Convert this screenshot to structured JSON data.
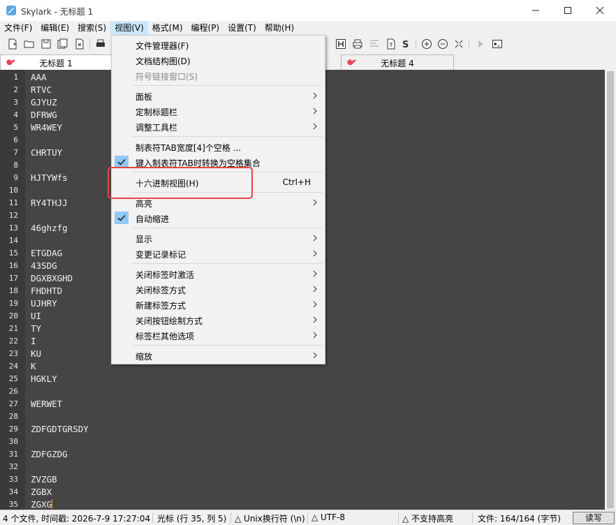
{
  "window": {
    "title": "Skylark - 无标题 1"
  },
  "menubar": [
    {
      "label": "文件(F)"
    },
    {
      "label": "编辑(E)"
    },
    {
      "label": "搜索(S)"
    },
    {
      "label": "视图(V)"
    },
    {
      "label": "格式(M)"
    },
    {
      "label": "编程(P)"
    },
    {
      "label": "设置(T)"
    },
    {
      "label": "帮助(H)"
    }
  ],
  "toolbar": {
    "icons": [
      "new-file-icon",
      "open-folder-icon",
      "save-icon",
      "save-all-icon",
      "close-file-icon",
      "print-icon",
      "hex-view-icon",
      "printer-icon",
      "align-icon",
      "text-file-icon",
      "s-icon",
      "zoom-in-icon",
      "zoom-out-icon",
      "fullscreen-icon",
      "run-icon",
      "terminal-icon"
    ]
  },
  "tabs": [
    {
      "label": "无标题 1",
      "active": true
    },
    {
      "label": "无标题 4",
      "active": false
    }
  ],
  "editor": {
    "lines": [
      "AAA",
      "RTVC",
      "GJYUZ",
      "DFRWG",
      "WR4WEY",
      "",
      "CHRTUY",
      "",
      "HJTYWfs",
      "",
      "RY4THJJ",
      "",
      "46ghzfg",
      "",
      "ETGDAG",
      "43SDG",
      "DGXBXGHD",
      "FHDHTD",
      "UJHRY",
      "UI",
      "TY",
      "I",
      "KU",
      "K",
      "HGKLY",
      "",
      "WERWET",
      "",
      "ZDFGDTGRSDY",
      "",
      "ZDFGZDG",
      "",
      "ZVZGB",
      "ZGBX",
      "ZGXG"
    ]
  },
  "statusbar": {
    "files": "4 个文件, 时间戳: 2026-7-9 17:27:04",
    "cursor": "光标 (行 35, 列 5)",
    "eol": "△ Unix换行符 (\\n)",
    "encoding": "△ UTF-8",
    "highlight": "△ 不支持高亮",
    "size": "文件: 164/164 (字节)",
    "mode": "读写"
  },
  "view_menu": {
    "items": [
      {
        "label": "文件管理器(F)"
      },
      {
        "label": "文档结构图(D)"
      },
      {
        "label": "符号链接窗口(S)",
        "disabled": true
      },
      {
        "label": "面板",
        "submenu": true
      },
      {
        "label": "定制标题栏",
        "submenu": true
      },
      {
        "label": "调整工具栏",
        "submenu": true
      },
      {
        "label": "制表符TAB宽度[4]个空格 ..."
      },
      {
        "label": "键入制表符TAB时转换为空格集合",
        "checked": true
      },
      {
        "label": "十六进制视图(H)",
        "shortcut": "Ctrl+H"
      },
      {
        "label": "高亮",
        "submenu": true
      },
      {
        "label": "自动缩进",
        "checked": true
      },
      {
        "label": "显示",
        "submenu": true
      },
      {
        "label": "变更记录标记",
        "submenu": true
      },
      {
        "label": "关闭标签时激活",
        "submenu": true
      },
      {
        "label": "关闭标签方式",
        "submenu": true
      },
      {
        "label": "新建标签方式",
        "submenu": true
      },
      {
        "label": "关闭按钮绘制方式",
        "submenu": true
      },
      {
        "label": "标签栏其他选项",
        "submenu": true
      },
      {
        "label": "缩放",
        "submenu": true
      }
    ]
  },
  "colors": {
    "editor_bg": "#454545",
    "menu_highlight": "#cce8ff",
    "check_bg": "#90c8f6",
    "callout": "#e8453c",
    "caret": "#ff9e2c"
  }
}
